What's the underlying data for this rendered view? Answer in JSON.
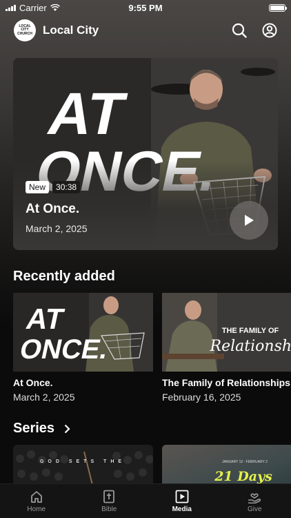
{
  "status_bar": {
    "carrier": "Carrier",
    "time": "9:55 PM"
  },
  "header": {
    "logo_text": [
      "LOCAL",
      "CITY",
      "CHURCH"
    ],
    "title": "Local City"
  },
  "hero": {
    "art_text_line1": "AT",
    "art_text_line2": "ONCE.",
    "badge_new": "New",
    "duration": "30:38",
    "title": "At Once.",
    "date": "March 2, 2025"
  },
  "recent": {
    "heading": "Recently added",
    "items": [
      {
        "title": "At Once.",
        "date": "March 2, 2025",
        "art_line1": "AT",
        "art_line2": "ONCE."
      },
      {
        "title": "The Family of Relationships",
        "date": "February 16, 2025",
        "art_line1": "THE FAMILY OF",
        "art_line2": "Relationships"
      }
    ]
  },
  "series": {
    "heading": "Series",
    "items": [
      {
        "art_text": "GOD SETS THE"
      },
      {
        "art_small": "JANUARY 12 - FEBRUARY 2",
        "art_text": "21 Days"
      }
    ]
  },
  "tabs": [
    {
      "label": "Home",
      "icon": "home-icon",
      "active": false
    },
    {
      "label": "Bible",
      "icon": "bible-icon",
      "active": false
    },
    {
      "label": "Media",
      "icon": "media-icon",
      "active": true
    },
    {
      "label": "Give",
      "icon": "give-icon",
      "active": false
    }
  ]
}
